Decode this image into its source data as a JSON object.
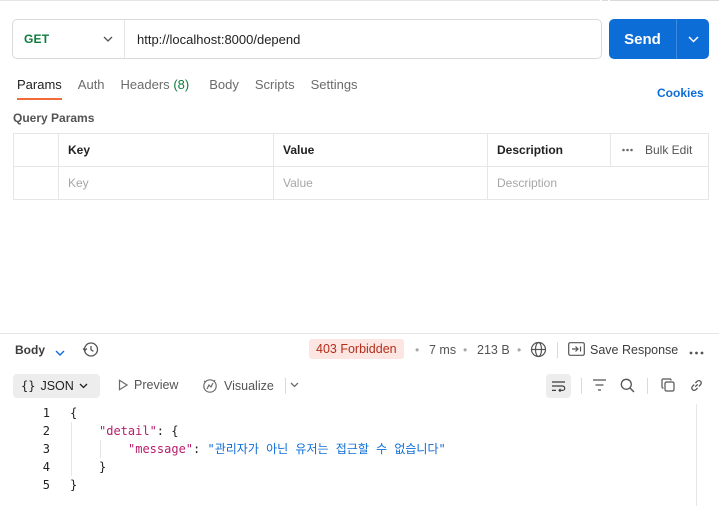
{
  "request": {
    "method": "GET",
    "url": "http://localhost:8000/depend",
    "send_label": "Send"
  },
  "tabs": {
    "params": "Params",
    "auth": "Auth",
    "headers": "Headers",
    "headers_count": "(8)",
    "body": "Body",
    "scripts": "Scripts",
    "settings": "Settings",
    "cookies": "Cookies"
  },
  "query_params": {
    "title": "Query Params",
    "columns": [
      "Key",
      "Value",
      "Description"
    ],
    "bulk_edit": "Bulk Edit",
    "placeholders": [
      "Key",
      "Value",
      "Description"
    ]
  },
  "response": {
    "body_label": "Body",
    "status": "403 Forbidden",
    "time": "7 ms",
    "size": "213 B",
    "save_label": "Save Response",
    "format": "JSON",
    "preview": "Preview",
    "visualize": "Visualize",
    "lines": [
      {
        "num": "1",
        "text": "{"
      },
      {
        "num": "2",
        "key": "\"detail\"",
        "after": ": {"
      },
      {
        "num": "3",
        "key": "\"message\"",
        "sep": ": ",
        "str": "\"관리자가 아닌 유저는 접근할 수 없습니다\""
      },
      {
        "num": "4",
        "text": "}"
      },
      {
        "num": "5",
        "text": "}"
      }
    ]
  },
  "colors": {
    "accent": "#0d6dd7",
    "tab_underline": "#f26b3a",
    "method_get": "#0f7b3c",
    "status_error_bg": "#fde6e2",
    "status_error_text": "#b32d1a",
    "json_key": "#b51d6b",
    "json_string": "#0d6dd7"
  }
}
